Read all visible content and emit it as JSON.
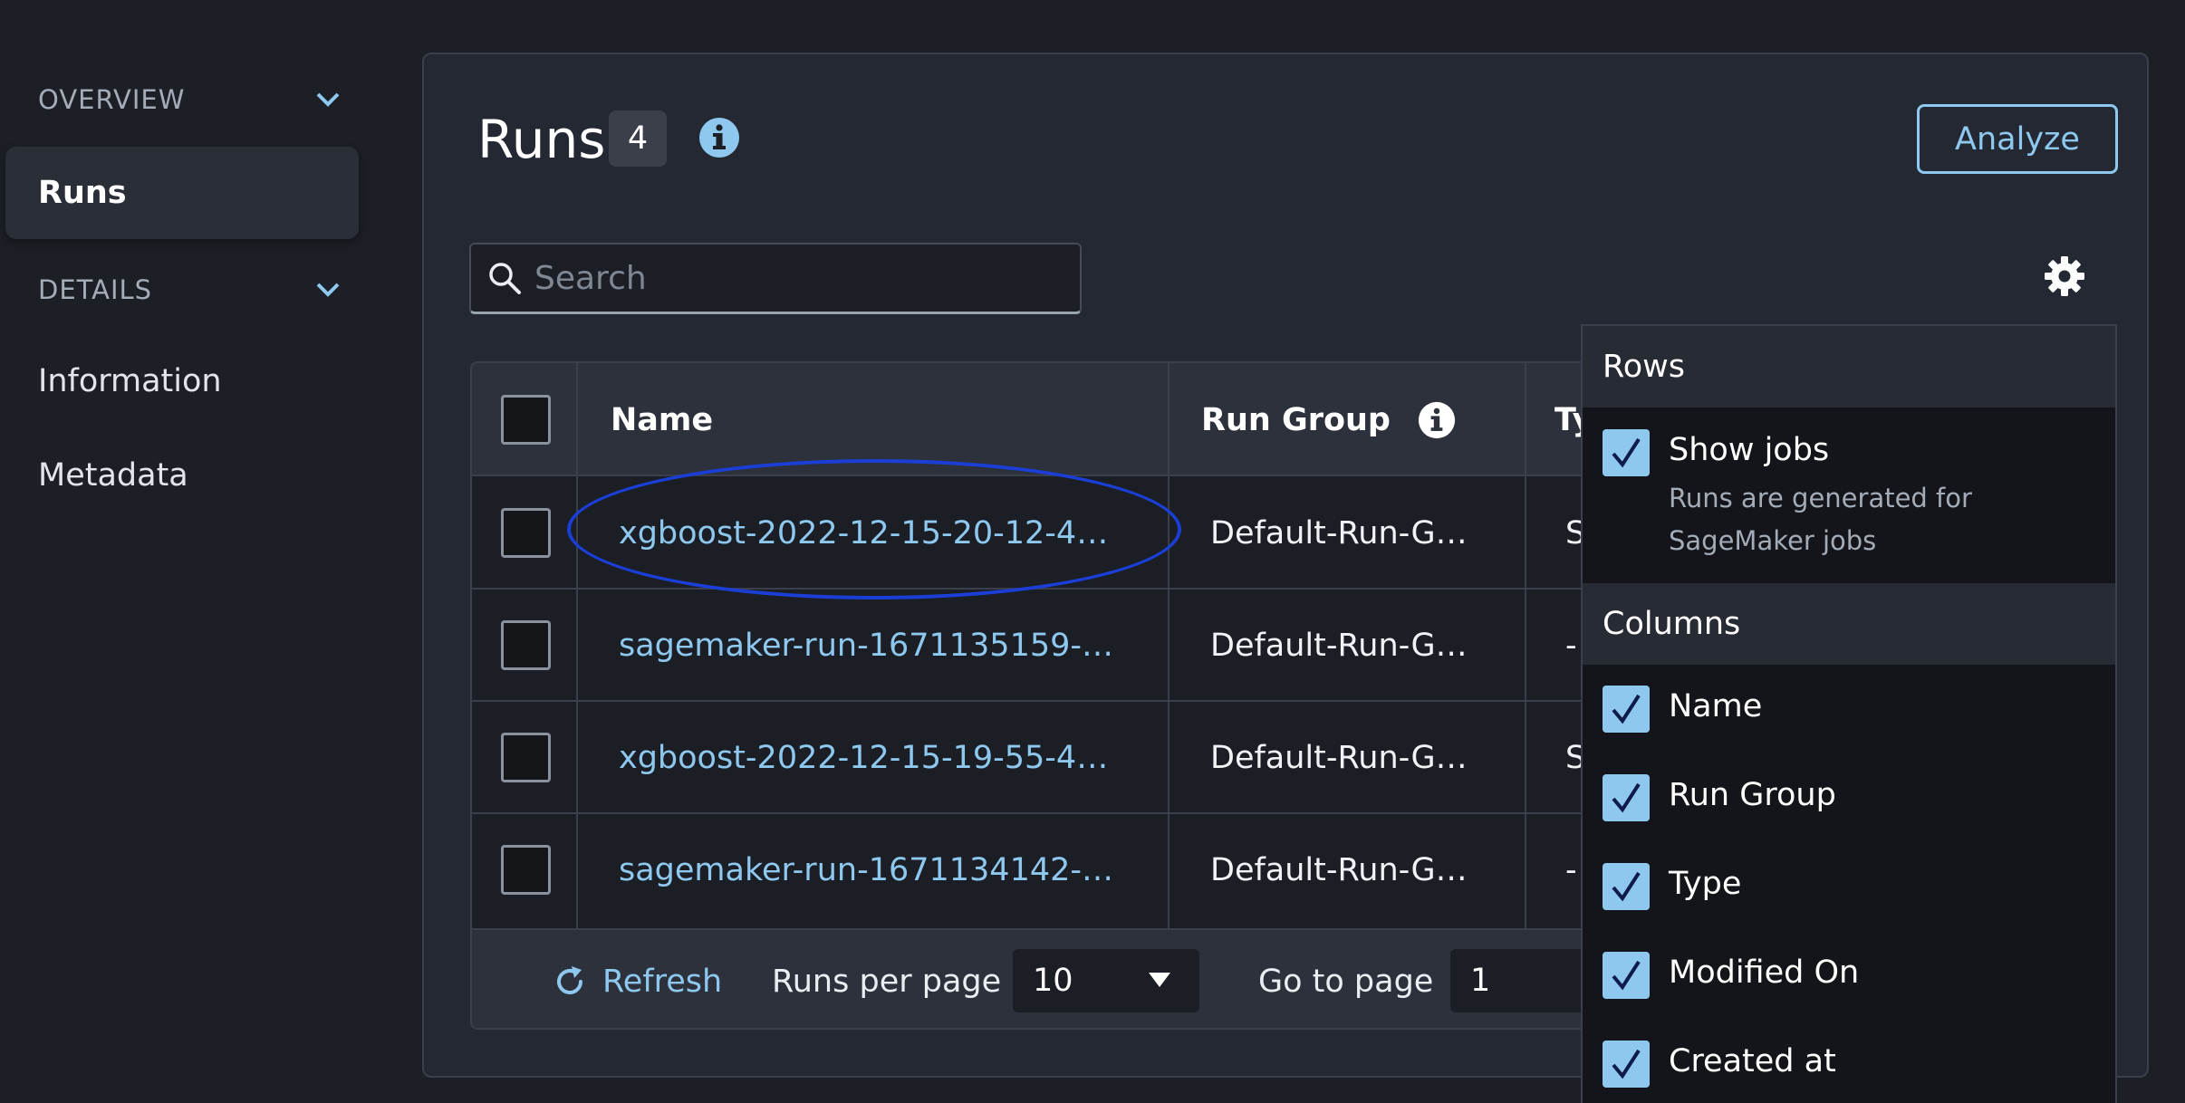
{
  "sidebar": {
    "overview_label": "OVERVIEW",
    "runs_label": "Runs",
    "details_label": "DETAILS",
    "information_label": "Information",
    "metadata_label": "Metadata"
  },
  "header": {
    "title": "Runs",
    "count": "4",
    "analyze_label": "Analyze"
  },
  "search": {
    "placeholder": "Search"
  },
  "table": {
    "columns": {
      "name": "Name",
      "run_group": "Run Group",
      "type": "Ty"
    },
    "rows": [
      {
        "name": "xgboost-2022-12-15-20-12-4…",
        "run_group": "Default-Run-G…",
        "type": "S"
      },
      {
        "name": "sagemaker-run-1671135159-…",
        "run_group": "Default-Run-G…",
        "type": "-"
      },
      {
        "name": "xgboost-2022-12-15-19-55-4…",
        "run_group": "Default-Run-G…",
        "type": "S"
      },
      {
        "name": "sagemaker-run-1671134142-…",
        "run_group": "Default-Run-G…",
        "type": "-"
      }
    ]
  },
  "footer": {
    "refresh_label": "Refresh",
    "runs_per_page_label": "Runs per page",
    "runs_per_page_value": "10",
    "go_to_page_label": "Go to page",
    "go_to_page_value": "1"
  },
  "preferences": {
    "rows_heading": "Rows",
    "show_jobs_label": "Show jobs",
    "show_jobs_desc_1": "Runs are generated for",
    "show_jobs_desc_2": "SageMaker jobs",
    "columns_heading": "Columns",
    "column_options": [
      "Name",
      "Run Group",
      "Type",
      "Modified On",
      "Created at"
    ]
  },
  "colors": {
    "accent": "#8ec8ef",
    "background": "#1c1f26",
    "annotation": "#1b3fd6"
  }
}
